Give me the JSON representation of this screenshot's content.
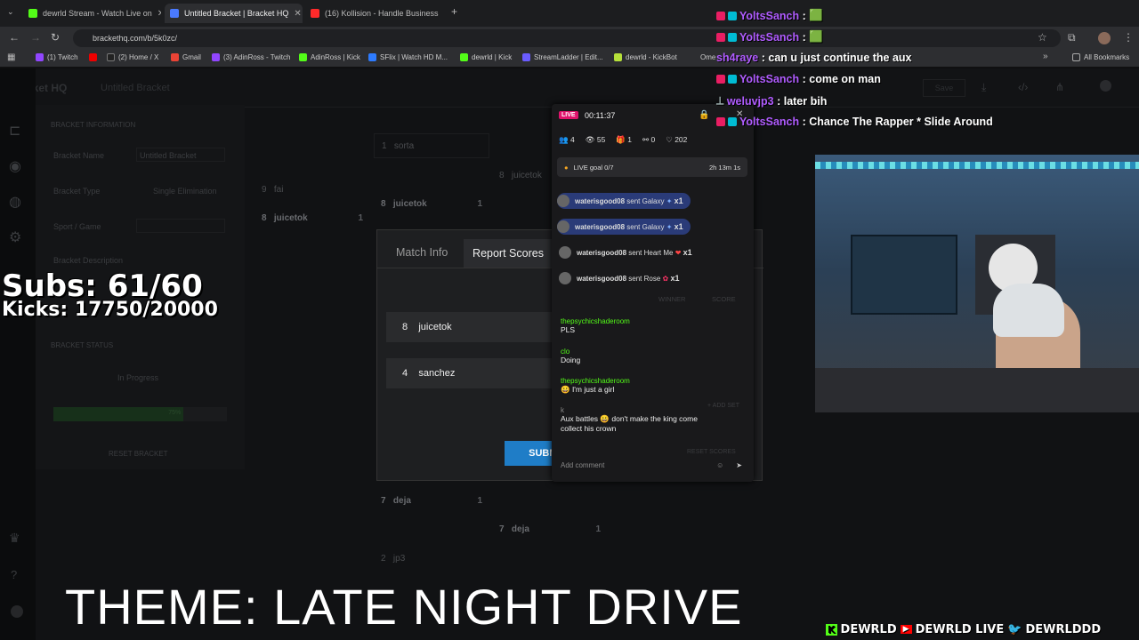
{
  "browser": {
    "tabs": [
      {
        "label": "dewrld Stream - Watch Live on",
        "color": "#53fc18"
      },
      {
        "label": "Untitled Bracket | Bracket HQ",
        "color": "#4a7aff"
      },
      {
        "label": "(16) Kollision - Handle Business",
        "color": "#ff2a2a"
      }
    ],
    "url": "brackethq.com/b/5k0zc/",
    "bookmarks": [
      "(1) Twitch",
      "(2) Home / X",
      "Gmail",
      "(3) AdinRoss - Twitch",
      "AdinRoss | Kick",
      "SFlix | Watch HD M...",
      "dewrld | Kick",
      "StreamLadder | Edit...",
      "dewrld - KickBot",
      "Ome"
    ],
    "all_bookmarks": "All Bookmarks"
  },
  "app": {
    "logo": "Bracket HQ",
    "title": "Untitled Bracket",
    "save": "Save",
    "sections": {
      "info_header": "BRACKET INFORMATION",
      "name_label": "Bracket Name",
      "name_value": "Untitled Bracket",
      "type_label": "Bracket Type",
      "type_value": "Single Elimination",
      "sport_label": "Sport / Game",
      "desc_label": "Bracket Description",
      "status_header": "BRACKET STATUS",
      "status_value": "In Progress",
      "progress_label": "75%",
      "reset": "RESET BRACKET"
    },
    "bracket": {
      "slots": [
        {
          "seed": "1",
          "name": "sorta"
        },
        {
          "seed": "9",
          "name": "fai"
        },
        {
          "seed": "8",
          "name": "juicetok"
        },
        {
          "seed": "8",
          "name": "juicetok"
        },
        {
          "seed": "8",
          "name": "juicetok"
        },
        {
          "seed": "7",
          "name": "deja"
        },
        {
          "seed": "7",
          "name": "deja"
        },
        {
          "seed": "2",
          "name": "jp3"
        }
      ],
      "win": "1"
    }
  },
  "modal": {
    "tab_info": "Match Info",
    "tab_report": "Report Scores",
    "col_winner": "WINNER",
    "col_score": "SCORE",
    "players": [
      {
        "seed": "8",
        "name": "juicetok"
      },
      {
        "seed": "4",
        "name": "sanchez"
      }
    ],
    "add_set": "+ ADD SET",
    "reset_scores": "RESET SCORES",
    "submit": "SUBMIT SCORES"
  },
  "overlay": {
    "subs": "Subs: 61/60",
    "kicks": "Kicks: 17750/20000",
    "theme": "THEME: LATE NIGHT DRIVE",
    "socials": [
      "DEWRLD",
      "DEWRLD LIVE",
      "DEWRLDDD"
    ]
  },
  "kick": {
    "live": "LIVE",
    "timer": "00:11:37",
    "stats": [
      "4",
      "55",
      "1",
      "0",
      "202"
    ],
    "goal": "LIVE goal",
    "goal_value": "0/7",
    "goal_time": "2h 13m 1s",
    "gifts": [
      {
        "user": "waterisgood08",
        "text": "sent Galaxy",
        "count": "x1"
      },
      {
        "user": "waterisgood08",
        "text": "sent Galaxy",
        "count": "x1"
      },
      {
        "user": "waterisgood08",
        "text": "sent Heart Me",
        "count": "x1"
      },
      {
        "user": "waterisgood08",
        "text": "sent Rose",
        "count": "x1"
      }
    ],
    "chat": [
      {
        "user": "thepsychicshaderoom",
        "text": "PLS"
      },
      {
        "user": "clo",
        "text": "Doing"
      },
      {
        "user": "thepsychicshaderoom",
        "text": "😀 I'm just a girl"
      },
      {
        "user": "k",
        "text": "Aux battles 😀 don't make the king come collect his crown"
      }
    ],
    "comment_placeholder": "Add comment"
  },
  "twitch_chat": [
    {
      "user": "YoltsSanch",
      "msg": "🟩",
      "color": "#b05cff"
    },
    {
      "user": "YoltsSanch",
      "msg": "🟩",
      "color": "#b05cff"
    },
    {
      "user": "sh4raye",
      "msg": "can u just continue the aux",
      "color": "#b05cff"
    },
    {
      "user": "YoltsSanch",
      "msg": "come on man",
      "color": "#b05cff"
    },
    {
      "user": "weluvjp3",
      "msg": "later bih",
      "color": "#b05cff"
    },
    {
      "user": "YoltsSanch",
      "msg": "Chance The Rapper * Slide Around",
      "color": "#b05cff"
    }
  ]
}
